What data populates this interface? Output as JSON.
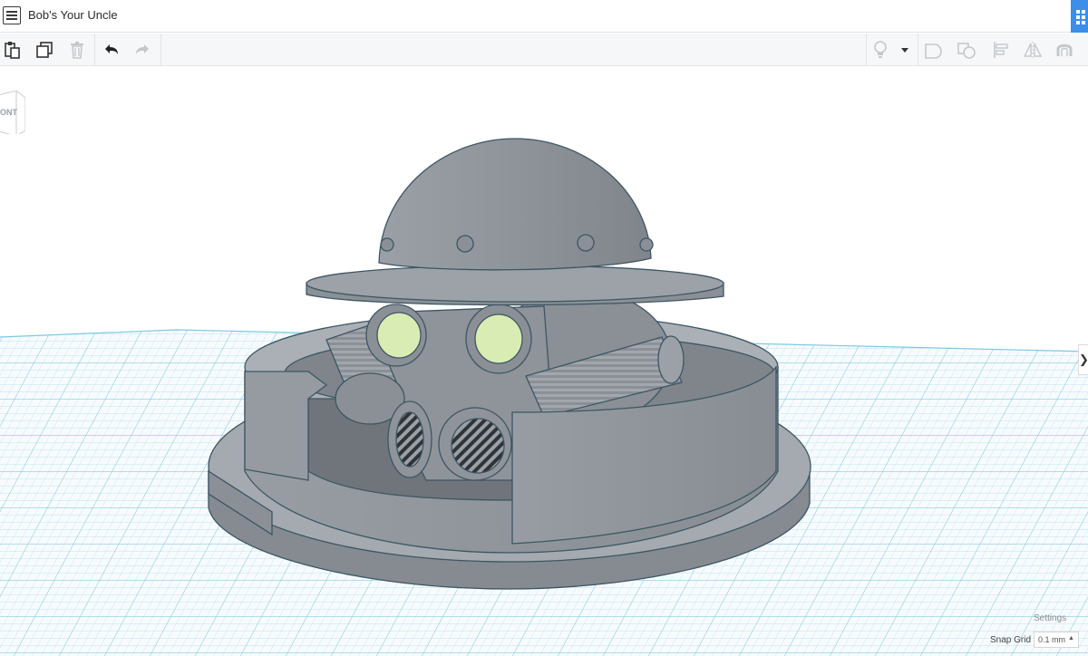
{
  "title": "Bob's Your Uncle",
  "toolbar": {
    "left_tools": [
      "paste-icon",
      "duplicate-icon",
      "delete-icon",
      "undo-icon",
      "redo-icon"
    ],
    "right_tools": [
      "lightbulb-icon",
      "dropdown-caret-icon",
      "group-icon",
      "ungroup-icon",
      "align-icon",
      "mirror-icon",
      "magnet-icon"
    ]
  },
  "viewcube": {
    "label": "ONT"
  },
  "workplane": {
    "grid_color": "#7ec8e3",
    "model_color": "#8e949a",
    "lens_color": "#d9ecb3"
  },
  "status": {
    "settings_label": "Settings",
    "snap_grid_label": "Snap Grid",
    "snap_grid_value": "0.1 mm"
  },
  "panel_toggle": {
    "glyph": "❯"
  },
  "colors": {
    "accent": "#3c8ee8"
  }
}
